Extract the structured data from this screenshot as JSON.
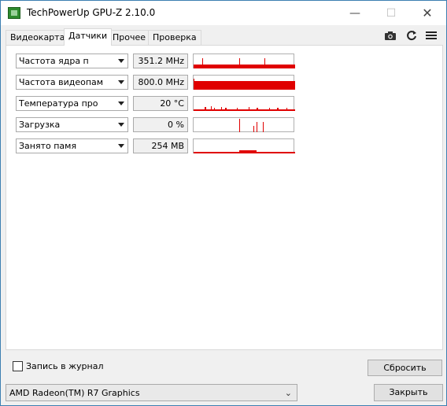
{
  "window": {
    "title": "TechPowerUp GPU-Z 2.10.0"
  },
  "tabs": [
    {
      "label": "Видеокарта"
    },
    {
      "label": "Датчики"
    },
    {
      "label": "Прочее"
    },
    {
      "label": "Проверка"
    }
  ],
  "toolbar": {
    "camera_icon": "camera-icon",
    "refresh_icon": "refresh-icon",
    "menu_icon": "hamburger-menu-icon"
  },
  "sensors": [
    {
      "label": "Частота ядра п",
      "value": "351.2 MHz"
    },
    {
      "label": "Частота видеопам",
      "value": "800.0 MHz"
    },
    {
      "label": "Температура про",
      "value": "20 °C"
    },
    {
      "label": "Загрузка",
      "value": "0 %"
    },
    {
      "label": "Занято памя",
      "value": "254 MB"
    }
  ],
  "footer": {
    "log_label": "Запись в журнал",
    "reset_label": "Сбросить",
    "gpu_selected": "AMD Radeon(TM) R7 Graphics",
    "close_label": "Закрыть"
  },
  "colors": {
    "graph": "#e00000",
    "window_border": "#3c7fb1"
  }
}
